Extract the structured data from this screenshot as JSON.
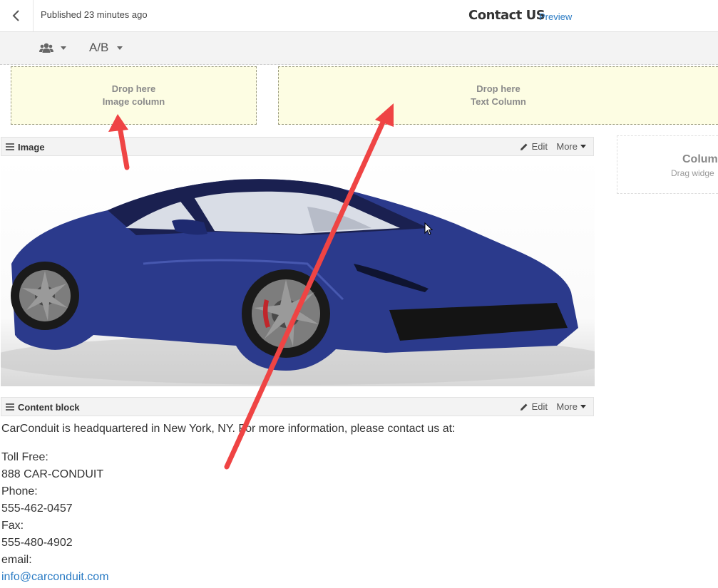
{
  "header": {
    "published_status": "Published 23 minutes ago",
    "page_title": "Contact US",
    "preview_label": "Preview"
  },
  "toolbar": {
    "audience_icon": "users-icon",
    "ab_label": "A/B"
  },
  "drop_zones": [
    {
      "line1": "Drop here",
      "line2": "Image column"
    },
    {
      "line1": "Drop here",
      "line2": "Text Column"
    }
  ],
  "column_placeholder": {
    "title": "Colum",
    "subtitle": "Drag widge"
  },
  "image_widget": {
    "title": "Image",
    "edit_label": "Edit",
    "more_label": "More",
    "image_subject": "blue sports car"
  },
  "content_widget": {
    "title": "Content block",
    "edit_label": "Edit",
    "more_label": "More"
  },
  "content": {
    "intro": "CarConduit is headquartered in New York, NY. For more information, please contact us at:",
    "toll_free_label": "Toll Free:",
    "toll_free_value": "888 CAR-CONDUIT",
    "phone_label": "Phone:",
    "phone_value": "555-462-0457",
    "fax_label": "Fax:",
    "fax_value": "555-480-4902",
    "email_label": "email:",
    "email_value": "info@carconduit.com"
  },
  "colors": {
    "link": "#2a7bc4",
    "drop_zone_bg": "#fdfde3",
    "annotation_arrow": "#ef4444",
    "car_body": "#2b3a8c"
  }
}
